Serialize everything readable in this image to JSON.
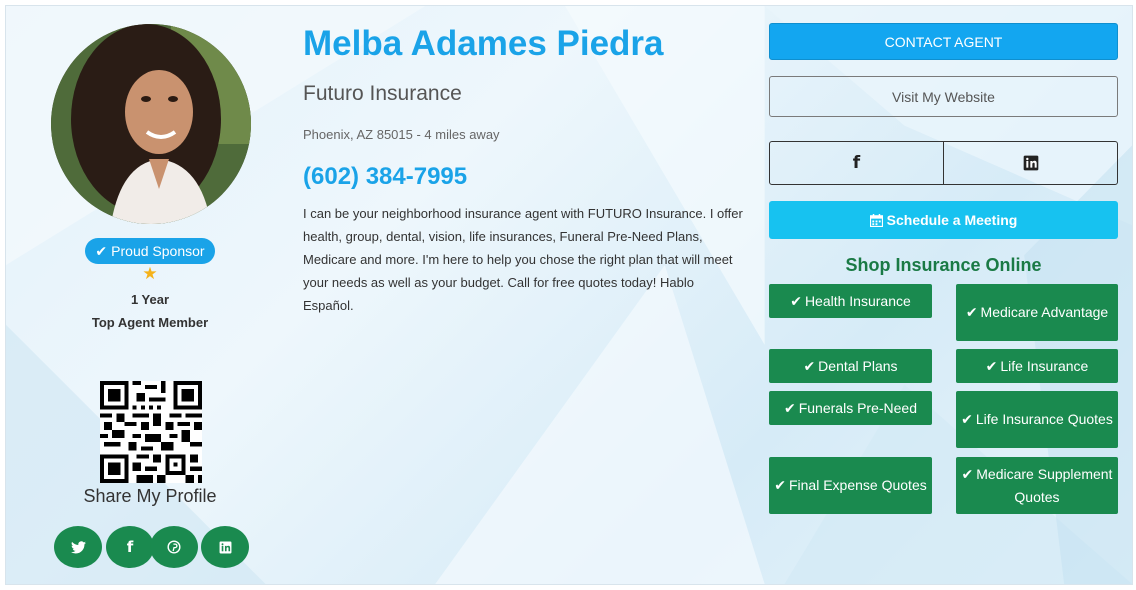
{
  "agent": {
    "name": "Melba Adames Piedra",
    "company": "Futuro Insurance",
    "location": "Phoenix, AZ 85015 - 4 miles away",
    "phone": "(602) 384-7995",
    "bio": "I can be your neighborhood insurance agent with FUTURO Insurance. I offer health, group, dental, vision, life insurances, Funeral Pre-Need Plans, Medicare and more. I'm here to help you chose the right plan that will meet your needs as well as your budget. Call for free quotes today! Hablo Español."
  },
  "badges": {
    "sponsor_label": "Proud Sponsor",
    "star_icon": "star-icon",
    "years": "1 Year",
    "member": "Top Agent Member"
  },
  "share": {
    "label": "Share My Profile",
    "icons": [
      "twitter-icon",
      "facebook-icon",
      "pinterest-icon",
      "linkedin-icon"
    ]
  },
  "actions": {
    "contact": "CONTACT AGENT",
    "website": "Visit My Website",
    "social": [
      "facebook-icon",
      "linkedin-icon"
    ],
    "meeting": "Schedule a Meeting"
  },
  "shop": {
    "title": "Shop Insurance Online",
    "items": [
      "Health Insurance",
      "Medicare Advantage",
      "Dental Plans",
      "Life Insurance",
      "Funerals Pre-Need",
      "Life Insurance Quotes",
      "Final Expense Quotes",
      "Medicare Supplement Quotes"
    ]
  },
  "colors": {
    "accent_blue": "#1aa3e8",
    "contact_button": "#13a6f0",
    "meeting_button": "#17c2f0",
    "shop_green": "#1a8a4f",
    "shop_title": "#1a7a45",
    "star": "#f5b21a"
  }
}
